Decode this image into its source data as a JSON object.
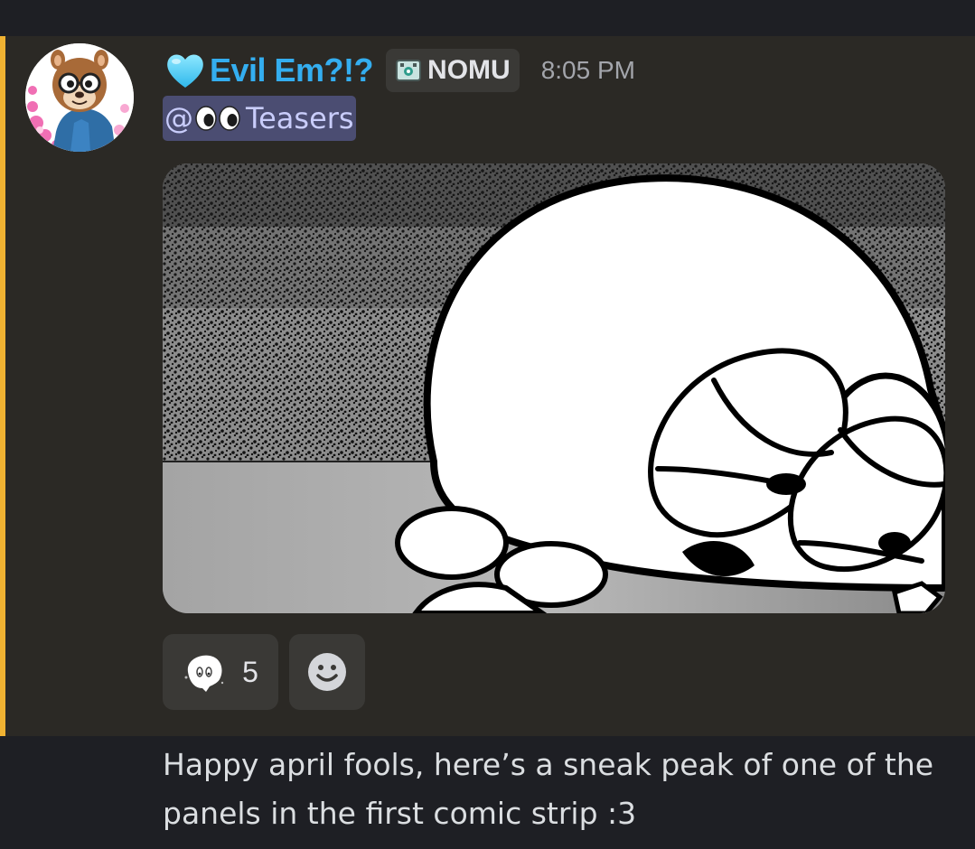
{
  "message": {
    "author": {
      "display_name": "Evil Em?!?",
      "name_color": "#34aef0",
      "name_icon": "light-blue-heart-icon",
      "avatar": "chipmunk-avatar",
      "guild_tag": {
        "icon": "tag-badge-icon",
        "label": "NOMU"
      }
    },
    "timestamp": "8:05 PM",
    "role_mention": {
      "prefix": "@",
      "icon": "eyes-emoji-icon",
      "label": "Teasers"
    },
    "attachment": {
      "description": "comic-panel-image"
    },
    "reactions": [
      {
        "emoji": "ghost-character-emoji",
        "count": "5"
      }
    ],
    "add_reaction_icon": "smiley-face-icon"
  },
  "followup_message": {
    "text": "Happy april fools, here’s a sneak peak of one of the panels in the first comic strip :3"
  },
  "colors": {
    "mention_bar": "#f0b232",
    "highlight_bg": "#2b2925",
    "page_bg": "#1e1f24",
    "role_mention_bg": "#4b4d72",
    "role_mention_text": "#c9cdfb"
  }
}
